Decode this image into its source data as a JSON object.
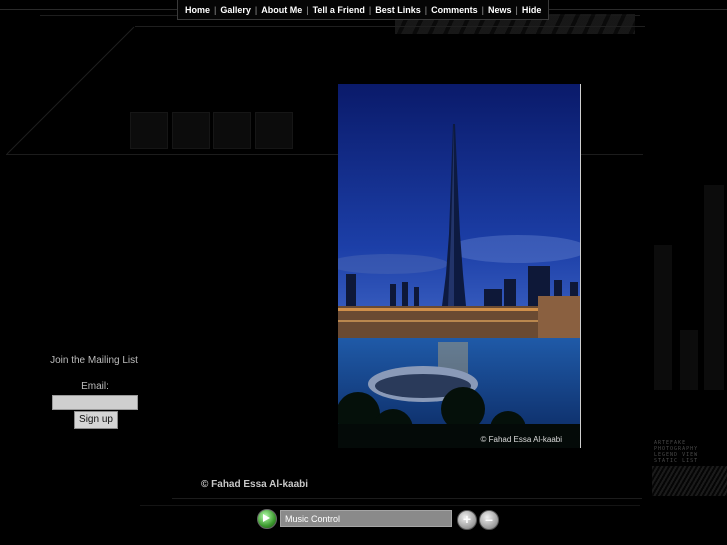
{
  "nav": {
    "items": [
      "Home",
      "Gallery",
      "About Me",
      "Tell a Friend",
      "Best Links",
      "Comments",
      "News",
      "Hide"
    ],
    "separator": "|"
  },
  "photo": {
    "credit": "© Fahad Essa Al-kaabi"
  },
  "mailing": {
    "title": "Join the Mailing List",
    "email_label": "Email:",
    "email_value": "",
    "signup_label": "Sign up"
  },
  "footer": {
    "copyright": "© Fahad Essa Al-kaabi"
  },
  "music": {
    "label": "Music Control",
    "plus": "+",
    "minus": "–"
  },
  "side_text": "ARTEFAKE PHOTOGRAPHY LEGEND VIEW STATIC LIST"
}
